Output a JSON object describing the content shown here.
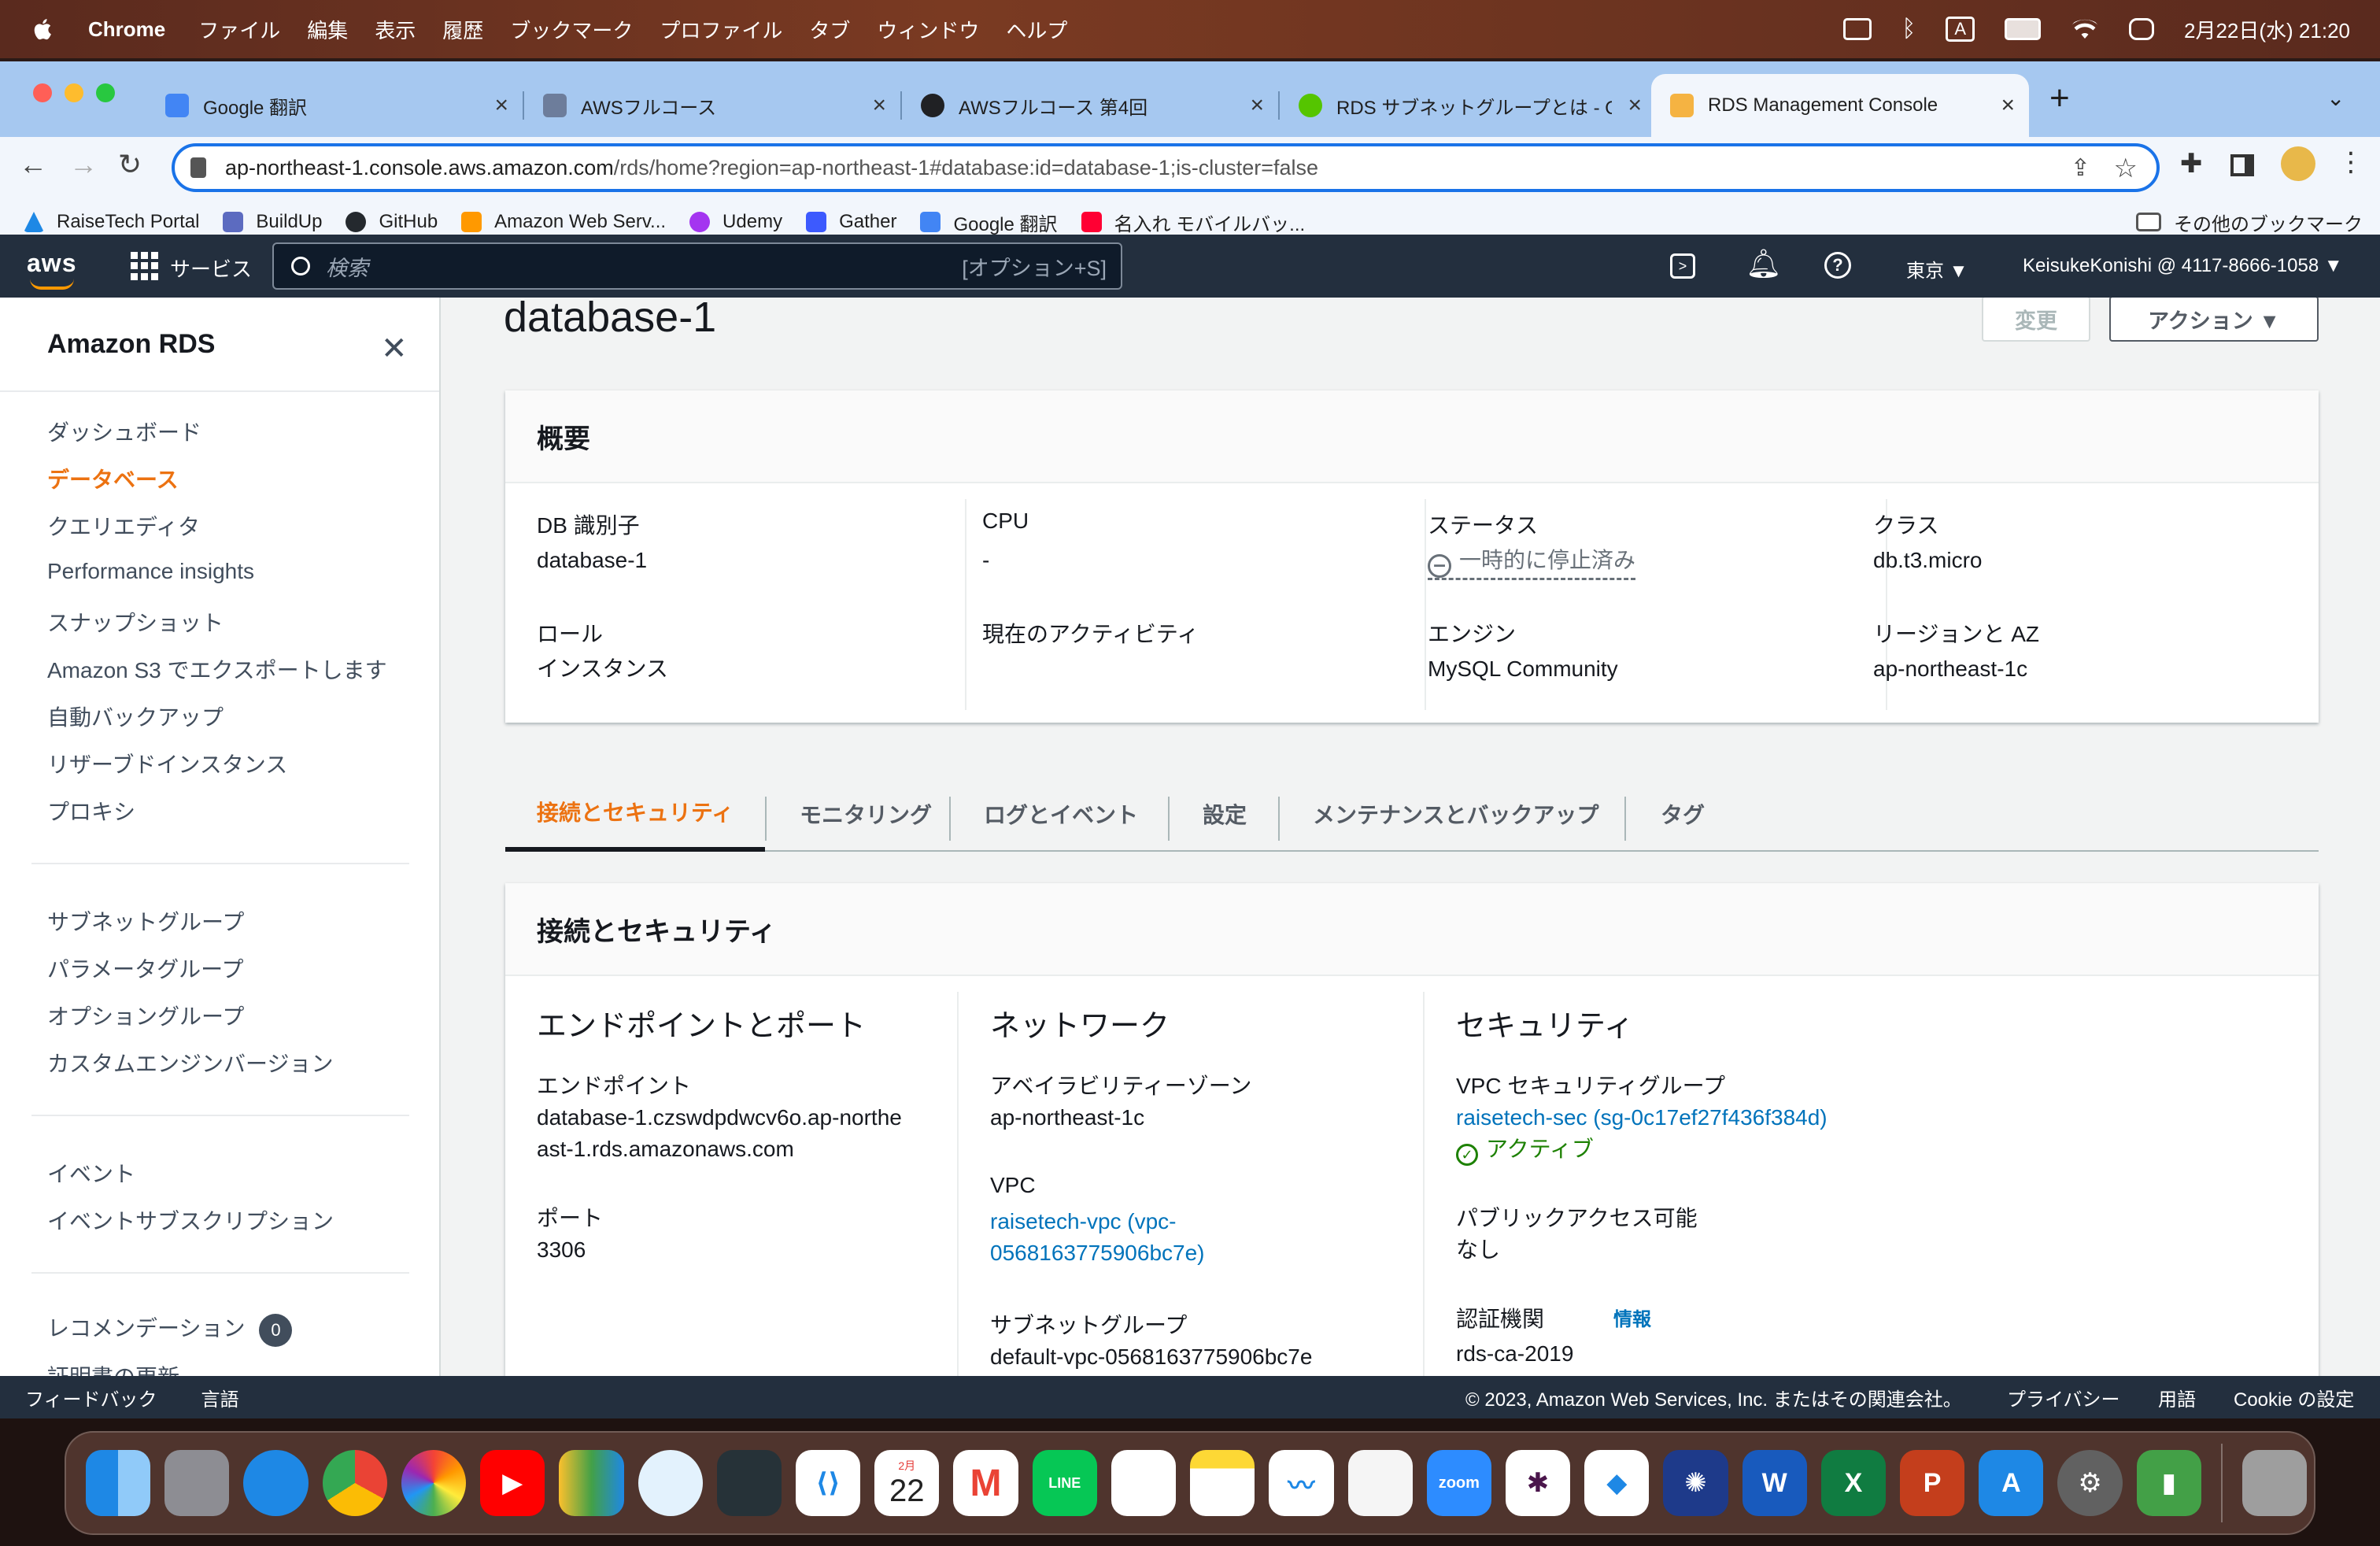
{
  "menubar": {
    "app": "Chrome",
    "items": [
      "ファイル",
      "編集",
      "表示",
      "履歴",
      "ブックマーク",
      "プロファイル",
      "タブ",
      "ウィンドウ",
      "ヘルプ"
    ],
    "datetime": "2月22日(水) 21:20",
    "input_indicator": "A"
  },
  "tabs": [
    {
      "title": "Google 翻訳",
      "color": "#4285f4"
    },
    {
      "title": "AWSフルコース",
      "color": "#6d7d9b"
    },
    {
      "title": "AWSフルコース 第4回",
      "color": "#202124"
    },
    {
      "title": "RDS サブネットグループとは - Qi",
      "color": "#55c500"
    },
    {
      "title": "RDS Management Console",
      "color": "#f5b342"
    }
  ],
  "address": {
    "domain": "ap-northeast-1.console.aws.amazon.com",
    "path": "/rds/home?region=ap-northeast-1#database:id=database-1;is-cluster=false"
  },
  "bookmarks": [
    {
      "label": "RaiseTech Portal",
      "color": "#1e88e5"
    },
    {
      "label": "BuildUp",
      "color": "#5c6bc0"
    },
    {
      "label": "GitHub",
      "color": "#24292e"
    },
    {
      "label": "Amazon Web Serv...",
      "color": "#ff9900"
    },
    {
      "label": "Udemy",
      "color": "#a435f0"
    },
    {
      "label": "Gather",
      "color": "#3d5afe"
    },
    {
      "label": "Google 翻訳",
      "color": "#4285f4"
    },
    {
      "label": "名入れ モバイルバッ...",
      "color": "#ff0033"
    }
  ],
  "other_bookmarks": "その他のブックマーク",
  "aws": {
    "logo": "aws",
    "services": "サービス",
    "search_placeholder": "検索",
    "search_shortcut": "[オプション+S]",
    "region": "東京 ▼",
    "account": "KeisukeKonishi @ 4117-8666-1058 ▼"
  },
  "sidebar": {
    "title": "Amazon RDS",
    "items": [
      "ダッシュボード",
      "データベース",
      "クエリエディタ",
      "Performance insights",
      "スナップショット",
      "Amazon S3 でエクスポートします",
      "自動バックアップ",
      "リザーブドインスタンス",
      "プロキシ"
    ],
    "items2": [
      "サブネットグループ",
      "パラメータグループ",
      "オプショングループ",
      "カスタムエンジンバージョン"
    ],
    "items3": [
      "イベント",
      "イベントサブスクリプション"
    ],
    "recommend": "レコメンデーション",
    "recommend_count": "0",
    "cut": "証明書の更新"
  },
  "page": {
    "title": "database-1",
    "modify": "変更",
    "actions": "アクション ▼"
  },
  "summary": {
    "header": "概要",
    "db_id_label": "DB 識別子",
    "db_id": "database-1",
    "cpu_label": "CPU",
    "cpu": "-",
    "status_label": "ステータス",
    "status": "一時的に停止済み",
    "class_label": "クラス",
    "class": "db.t3.micro",
    "role_label": "ロール",
    "role": "インスタンス",
    "activity_label": "現在のアクティビティ",
    "engine_label": "エンジン",
    "engine": "MySQL Community",
    "region_label": "リージョンと AZ",
    "region": "ap-northeast-1c"
  },
  "detail_tabs": [
    "接続とセキュリティ",
    "モニタリング",
    "ログとイベント",
    "設定",
    "メンテナンスとバックアップ",
    "タグ"
  ],
  "conn": {
    "header": "接続とセキュリティ",
    "ep_title": "エンドポイントとポート",
    "endpoint_label": "エンドポイント",
    "endpoint": "database-1.czswdpdwcv6o.ap-northeast-1.rds.amazonaws.com",
    "port_label": "ポート",
    "port": "3306",
    "net_title": "ネットワーク",
    "az_label": "アベイラビリティーゾーン",
    "az": "ap-northeast-1c",
    "vpc_label": "VPC",
    "vpc": "raisetech-vpc (vpc-0568163775906bc7e)",
    "subnet_label": "サブネットグループ",
    "subnet": "default-vpc-0568163775906bc7e",
    "sec_title": "セキュリティ",
    "sg_label": "VPC セキュリティグループ",
    "sg": "raisetech-sec (sg-0c17ef27f436f384d)",
    "sg_status": "アクティブ",
    "public_label": "パブリックアクセス可能",
    "public": "なし",
    "ca_label": "認証機関",
    "ca_info": "情報",
    "ca": "rds-ca-2019"
  },
  "footer": {
    "feedback": "フィードバック",
    "language": "言語",
    "copyright": "© 2023, Amazon Web Services, Inc. またはその関連会社。",
    "privacy": "プライバシー",
    "terms": "用語",
    "cookie": "Cookie の設定"
  },
  "dock": {
    "calendar_month": "2月",
    "calendar_day": "22",
    "zoom": "zoom",
    "line": "LINE",
    "word": "W",
    "excel": "X",
    "ppt": "P"
  }
}
